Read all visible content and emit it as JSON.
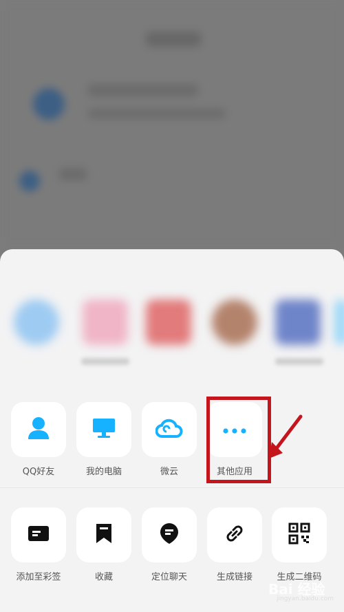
{
  "row1": [
    {
      "label": "QQ好友",
      "icon": "qq-friend-icon"
    },
    {
      "label": "我的电脑",
      "icon": "computer-icon"
    },
    {
      "label": "微云",
      "icon": "cloud-icon"
    },
    {
      "label": "其他应用",
      "icon": "more-icon"
    }
  ],
  "row2": [
    {
      "label": "添加至彩签",
      "icon": "tag-card-icon"
    },
    {
      "label": "收藏",
      "icon": "bookmark-icon"
    },
    {
      "label": "定位聊天",
      "icon": "location-chat-icon"
    },
    {
      "label": "生成链接",
      "icon": "link-icon"
    },
    {
      "label": "生成二维码",
      "icon": "qr-code-icon"
    }
  ],
  "colors": {
    "accent": "#16b1ff",
    "highlight": "#c4151c",
    "sheet": "#f3f3f4"
  },
  "watermark": {
    "main": "Bai 经验",
    "sub": "jingyan.baidu.com"
  }
}
